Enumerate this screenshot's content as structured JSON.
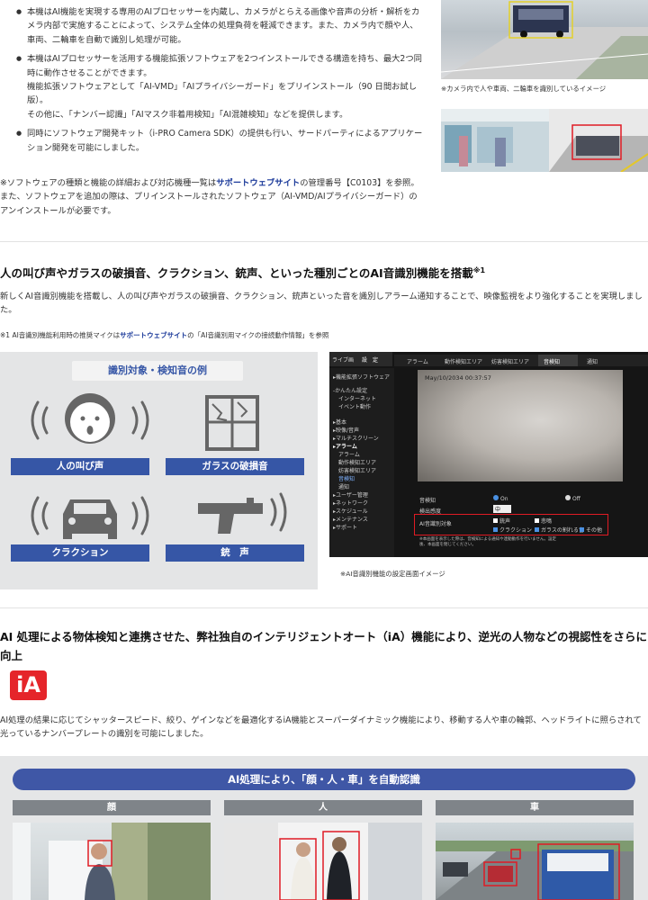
{
  "top": {
    "bullets": [
      "本機はAI機能を実現する専用のAIプロセッサーを内蔵し、カメラがとらえる画像や音声の分析・解析をカメラ内部で実施することによって、システム全体の処理負荷を軽減できます。また、カメラ内で顔や人、車両、二輪車を自動で識別し処理が可能。",
      "本機はAIプロセッサーを活用する機能拡張ソフトウェアを2つインストールできる構造を持ち、最大2つ同時に動作させることができます。",
      "同時にソフトウェア開発キット（i-PRO Camera SDK）の提供も行い、サードパーティによるアプリケーション開発を可能にしました。"
    ],
    "bullet2_extra": "機能拡張ソフトウェアとして「AI-VMD」「AIプライバシーガード」をプリインストール（90 日間お試し版）。",
    "bullet2_extra2": "その他に、「ナンバー認識」「AIマスク非着用検知」「AI混雑検知」などを提供します。",
    "note_prefix": "※ソフトウェアの種類と機能の詳細および対応機種一覧は",
    "note_link": "サポートウェブサイト",
    "note_suffix": "の管理番号【C0103】を参照。また、ソフトウェアを追加の際は、プリインストールされたソフトウェア（AI-VMD/AIプライバシーガード）のアンインストールが必要です。",
    "photo_caption": "※カメラ内で人や車両、二輪車を識別しているイメージ"
  },
  "audio": {
    "heading": "人の叫び声やガラスの破損音、クラクション、銃声、といった種別ごとのAI音識別機能を搭載",
    "heading_sup": "※1",
    "body": "新しくAI音識別機能を搭載し、人の叫び声やガラスの破損音、クラクション、銃声といった音を識別しアラーム通知することで、映像監視をより強化することを実現しました。",
    "footnote_prefix": "※1 AI音識別機能利用時の推奨マイクは",
    "footnote_link": "サポートウェブサイト",
    "footnote_suffix": "の「AI音識別用マイクの接続動作情報」を参照",
    "example_title": "識別対象・検知音の例",
    "labels": [
      "人の叫び声",
      "ガラスの破損音",
      "クラクション",
      "銃　声"
    ],
    "screen_caption": "※AI音識別機能の設定画面イメージ",
    "ui": {
      "top_tabs": [
        "ライブ画",
        "設　定"
      ],
      "sub_tabs": [
        "アラーム",
        "動作検知エリア",
        "妨害検知エリア",
        "音検知",
        "通知"
      ],
      "timestamp": "May/10/2034  00:37:57",
      "sidebar": [
        "▸機能拡張ソフトウェア",
        "-かんたん設定",
        "インターネット",
        "イベント動作",
        "▸基本",
        "▸映像/音声",
        "▸マルチスクリーン",
        "▸アラーム",
        "アラーム",
        "動作検知エリア",
        "妨害検知エリア",
        "音検知",
        "通知",
        "▸ユーザー管理",
        "▸ネットワーク",
        "▸スケジュール",
        "▸メンテナンス",
        "▸サポート"
      ],
      "row1_label": "音検知",
      "row1_on": "On",
      "row1_off": "Off",
      "row2_label": "検出感度",
      "row2_value": "中",
      "row3_label": "AI音識別対象",
      "opts": [
        "銃声",
        "悲鳴",
        "クラクション",
        "ガラスの割れる音",
        "その他"
      ],
      "warn": "※本画面を表示した際は、音検知による通知や連動動作を行いません。設定後、本画面を閉じてください。"
    }
  },
  "ia": {
    "heading": "AI 処理による物体検知と連携させた、弊社独自のインテリジェントオート（iA）機能により、逆光の人物などの視認性をさらに向上",
    "logo_text": "iA",
    "body": "AI処理の結果に応じてシャッタースピード、絞り、ゲインなどを最適化するiA機能とスーパーダイナミック機能により、移動する人や車の輪郭、ヘッドライトに照らされて光っているナンバープレートの識別を可能にしました。",
    "banner": "AI処理により、「顔・人・車」を自動認識",
    "columns": [
      "顔",
      "人",
      "車"
    ]
  },
  "colors": {
    "accent_blue": "#3656a6",
    "link_blue": "#1b3a9a",
    "detect_red": "#e01b24",
    "ia_red": "#e5252a"
  }
}
